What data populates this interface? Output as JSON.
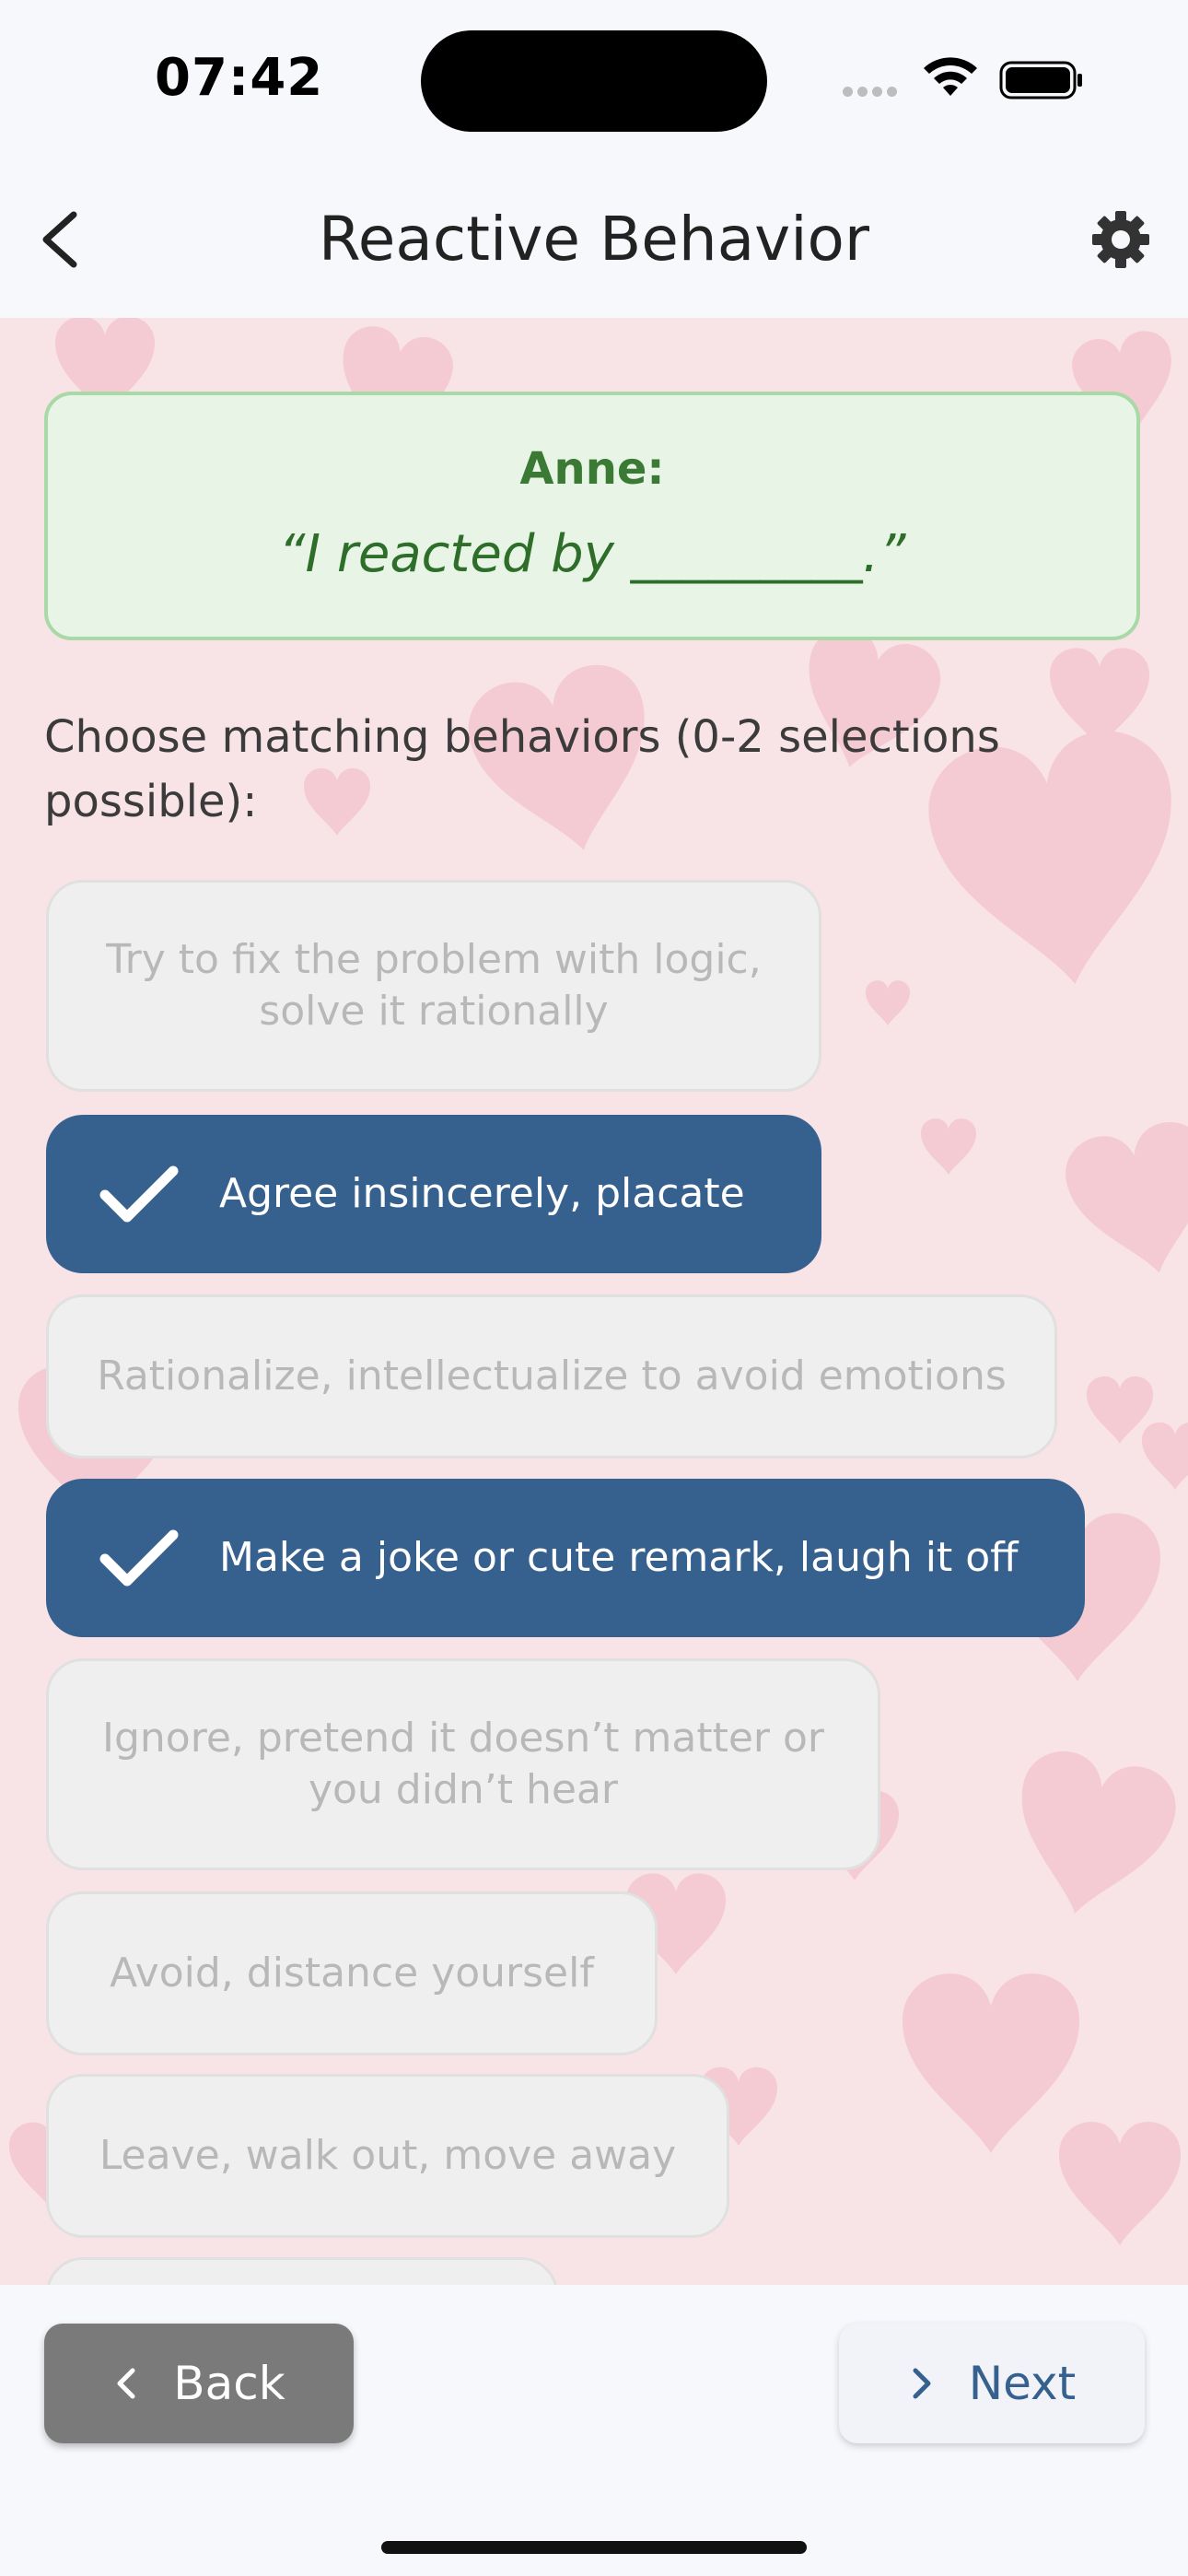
{
  "status_bar": {
    "time": "07:42"
  },
  "app_bar": {
    "title": "Reactive Behavior",
    "back_icon": "chevron-left-icon",
    "settings_icon": "gear-icon"
  },
  "quote_card": {
    "speaker": "Anne:",
    "quote": "“I reacted by _________.”"
  },
  "prompt": "Choose matching behaviors (0-2 selections possible):",
  "options": [
    {
      "label": "Try to fix the problem with logic,\nsolve it rationally",
      "selected": false
    },
    {
      "label": "Agree insincerely, placate",
      "selected": true
    },
    {
      "label": "Rationalize, intellectualize to avoid emotions",
      "selected": false
    },
    {
      "label": "Make a joke or cute remark, laugh it off",
      "selected": true
    },
    {
      "label": "Ignore, pretend it doesn’t matter or\nyou didn’t hear",
      "selected": false
    },
    {
      "label": "Avoid, distance yourself",
      "selected": false
    },
    {
      "label": "Leave, walk out, move away",
      "selected": false
    }
  ],
  "bottom_bar": {
    "back_label": "Back",
    "next_label": "Next"
  },
  "colors": {
    "selected_bg": "#36618f",
    "card_bg": "#e8f5e6",
    "card_text": "#2e6e2a",
    "content_bg": "#f8e3e7"
  }
}
